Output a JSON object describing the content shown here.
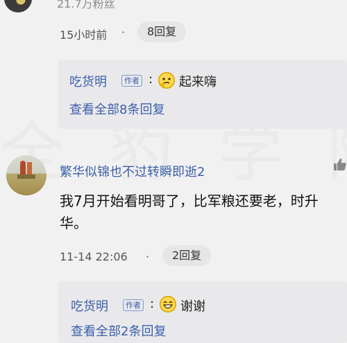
{
  "prev_comment": {
    "fans": "21.7万粉丝",
    "time": "15小时前",
    "separator": "·",
    "reply_count": "8回复",
    "reply_preview": {
      "author": "吃货明",
      "badge": "作者",
      "colon": ":",
      "emoji": "thinking-face-icon",
      "text": "起来嗨",
      "view_all": "查看全部8条回复"
    }
  },
  "comment": {
    "username": "繁华似锦也不过转瞬即逝2",
    "text": "我7月开始看明哥了，比军粮还要老，时升华。",
    "time": "11-14 22:06",
    "separator": "·",
    "reply_count": "2回复",
    "like_icon": "thumbs-up-icon",
    "reply_preview": {
      "author": "吃货明",
      "badge": "作者",
      "colon": ":",
      "emoji": "grinning-face-icon",
      "text": "谢谢",
      "view_all": "查看全部2条回复"
    }
  },
  "watermark": "全 豹 学 院",
  "colors": {
    "link_blue": "#3c5fa8",
    "background": "#f1f1f1",
    "reply_box": "#e9e9ec"
  }
}
